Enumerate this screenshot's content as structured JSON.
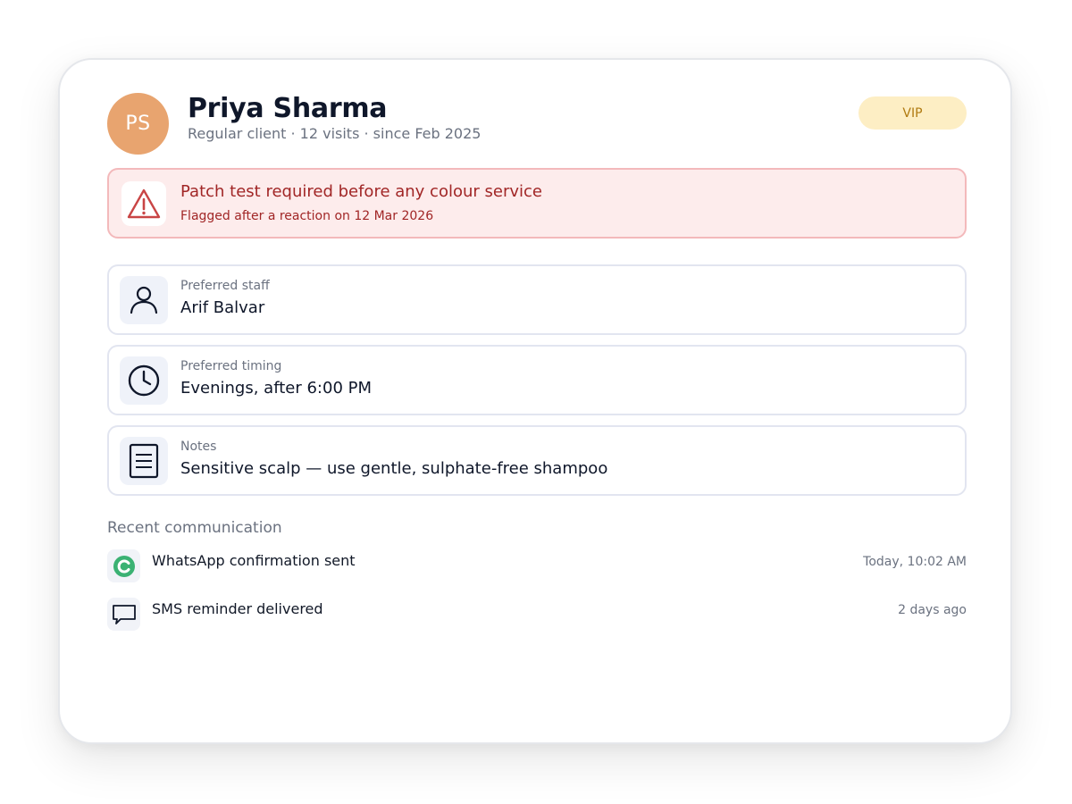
{
  "client": {
    "initials": "PS",
    "name": "Priya Sharma",
    "subline": "Regular client · 12 visits · since Feb 2025",
    "badge": "VIP"
  },
  "alert": {
    "title": "Patch test required before any colour service",
    "subtitle": "Flagged after a reaction on 12 Mar 2026",
    "icon": "warning-triangle-icon"
  },
  "details": [
    {
      "label": "Preferred staff",
      "value": "Arif Balvar",
      "icon": "person-icon"
    },
    {
      "label": "Preferred timing",
      "value": "Evenings, after 6:00 PM",
      "icon": "clock-icon"
    },
    {
      "label": "Notes",
      "value": "Sensitive scalp — use gentle, sulphate-free shampoo",
      "icon": "document-icon"
    }
  ],
  "communication": {
    "title": "Recent communication",
    "items": [
      {
        "text": "WhatsApp confirmation sent",
        "time": "Today, 10:02 AM",
        "icon": "whatsapp-icon"
      },
      {
        "text": "SMS reminder delivered",
        "time": "2 days ago",
        "icon": "chat-bubble-icon"
      }
    ]
  },
  "colors": {
    "avatar": "#e8a46f",
    "vip_bg": "#fdeec4",
    "vip_text": "#b07a10",
    "alert_bg": "#fdecec",
    "alert_border": "#f3b9bb",
    "alert_text": "#a12626",
    "whatsapp": "#3bb273"
  }
}
